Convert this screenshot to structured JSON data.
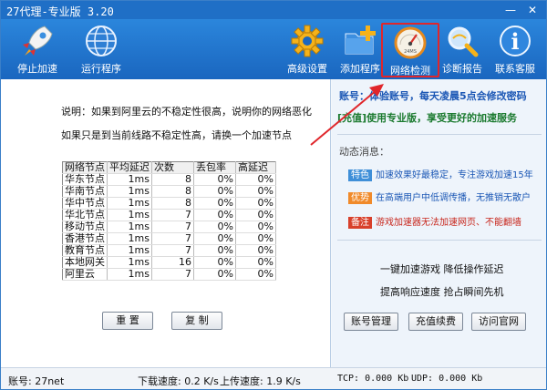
{
  "window": {
    "title": "27代理-专业版 3.20",
    "min_glyph": "—",
    "close_glyph": "✕"
  },
  "toolbar": {
    "items": [
      {
        "label": "停止加速",
        "icon": "rocket-icon"
      },
      {
        "label": "运行程序",
        "icon": "globe-icon"
      },
      {
        "label": "高级设置",
        "icon": "gear-icon"
      },
      {
        "label": "添加程序",
        "icon": "folder-plus-icon"
      },
      {
        "label": "网络检测",
        "icon": "speedometer-icon",
        "gauge_text": "24MS"
      },
      {
        "label": "诊断报告",
        "icon": "magnifier-icon"
      },
      {
        "label": "联系客服",
        "icon": "info-icon",
        "glyph": "i"
      }
    ]
  },
  "left": {
    "desc1": "说明：如果到阿里云的不稳定性很高，说明你的网络恶化",
    "desc2": "如果只是到当前线路不稳定性高，请换一个加速节点",
    "table": {
      "headers": [
        "网络节点",
        "平均延迟",
        "次数",
        "丢包率",
        "高延迟"
      ],
      "rows": [
        [
          "华东节点",
          "1ms",
          "8",
          "0%",
          "0%"
        ],
        [
          "华南节点",
          "1ms",
          "8",
          "0%",
          "0%"
        ],
        [
          "华中节点",
          "1ms",
          "8",
          "0%",
          "0%"
        ],
        [
          "华北节点",
          "1ms",
          "7",
          "0%",
          "0%"
        ],
        [
          "移动节点",
          "1ms",
          "7",
          "0%",
          "0%"
        ],
        [
          "香港节点",
          "1ms",
          "7",
          "0%",
          "0%"
        ],
        [
          "教育节点",
          "1ms",
          "7",
          "0%",
          "0%"
        ],
        [
          "本地网关",
          "1ms",
          "16",
          "0%",
          "0%"
        ],
        [
          "阿里云",
          "1ms",
          "7",
          "0%",
          "0%"
        ]
      ]
    },
    "reset_label": "重 置",
    "copy_label": "复 制"
  },
  "right": {
    "account_text": "账号：体验账号，每天凌晨5点会修改密码",
    "promo_text": "[充值]使用专业版，享受更好的加速服务",
    "news_title": "动态消息：",
    "news": [
      {
        "tag": "特色",
        "tag_color": "#3f8fd8",
        "text": "加速效果好最稳定，专注游戏加速15年",
        "text_color": "#1b57b5"
      },
      {
        "tag": "优势",
        "tag_color": "#f08a2a",
        "text": "在高端用户中低调传播，无推销无散户",
        "text_color": "#1b57b5"
      },
      {
        "tag": "备注",
        "tag_color": "#d8402b",
        "text": "游戏加速器无法加速网页、不能翻墙",
        "text_color": "#c8281e"
      }
    ],
    "slogan1": "一键加速游戏  降低操作延迟",
    "slogan2": "提高响应速度  抢占瞬间先机",
    "btn_account": "账号管理",
    "btn_recharge": "充值续费",
    "btn_website": "访问官网"
  },
  "status": {
    "account": "账号: 27net",
    "download": "下载速度: 0.2 K/s",
    "upload": "上传速度: 1.9 K/s",
    "tcp": "TCP:  0.000 Kb",
    "udp": "UDP:  0.000 Kb"
  },
  "colors": {
    "accent": "#1f6fc6",
    "highlight": "#e0262b"
  }
}
